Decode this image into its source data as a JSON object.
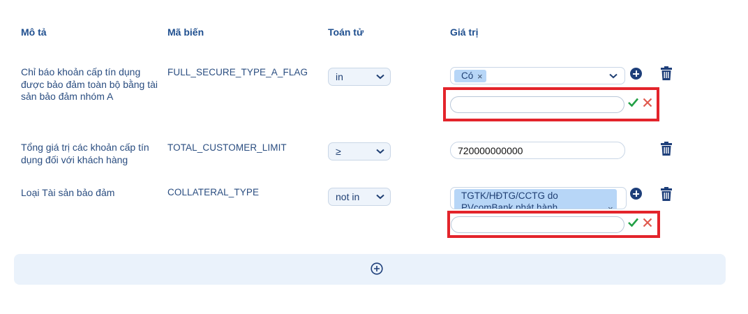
{
  "headers": {
    "description": "Mô tả",
    "variable_code": "Mã biến",
    "operator": "Toán tử",
    "value": "Giá trị"
  },
  "rows": [
    {
      "description": [
        "Chỉ báo khoản cấp tín dụng",
        "được bảo đảm toàn bộ bằng tài",
        "sản bảo đảm nhóm A"
      ],
      "variable_code": "FULL_SECURE_TYPE_A_FLAG",
      "operator": "in",
      "value_tags": [
        "Có"
      ],
      "new_value_input": ""
    },
    {
      "description": [
        "Tổng giá trị các khoản cấp tín",
        "dụng đối với khách hàng"
      ],
      "variable_code": "TOTAL_CUSTOMER_LIMIT",
      "operator": "≥",
      "value_text": "720000000000"
    },
    {
      "description": [
        "Loại Tài sản bảo đảm"
      ],
      "variable_code": "COLLATERAL_TYPE",
      "operator": "not in",
      "value_tags": [
        "TGTK/HĐTG/CCTG do PVcomBank phát hành"
      ],
      "value_tag_lines": [
        "TGTK/HĐTG/CCTG do",
        "PVcomBank phát hành"
      ],
      "new_value_input": ""
    }
  ],
  "icons": {
    "tag_remove": "×",
    "add_value": "plus-circle-icon",
    "delete_row": "trash-icon",
    "confirm": "check-icon",
    "cancel": "x-icon",
    "add_row": "plus-circle-outline-icon"
  },
  "colors": {
    "primary": "#1e3f7a",
    "highlight_box": "#e3242b",
    "confirm": "#22a045",
    "cancel": "#e05a4f",
    "tag_bg": "#b7d6f7"
  }
}
